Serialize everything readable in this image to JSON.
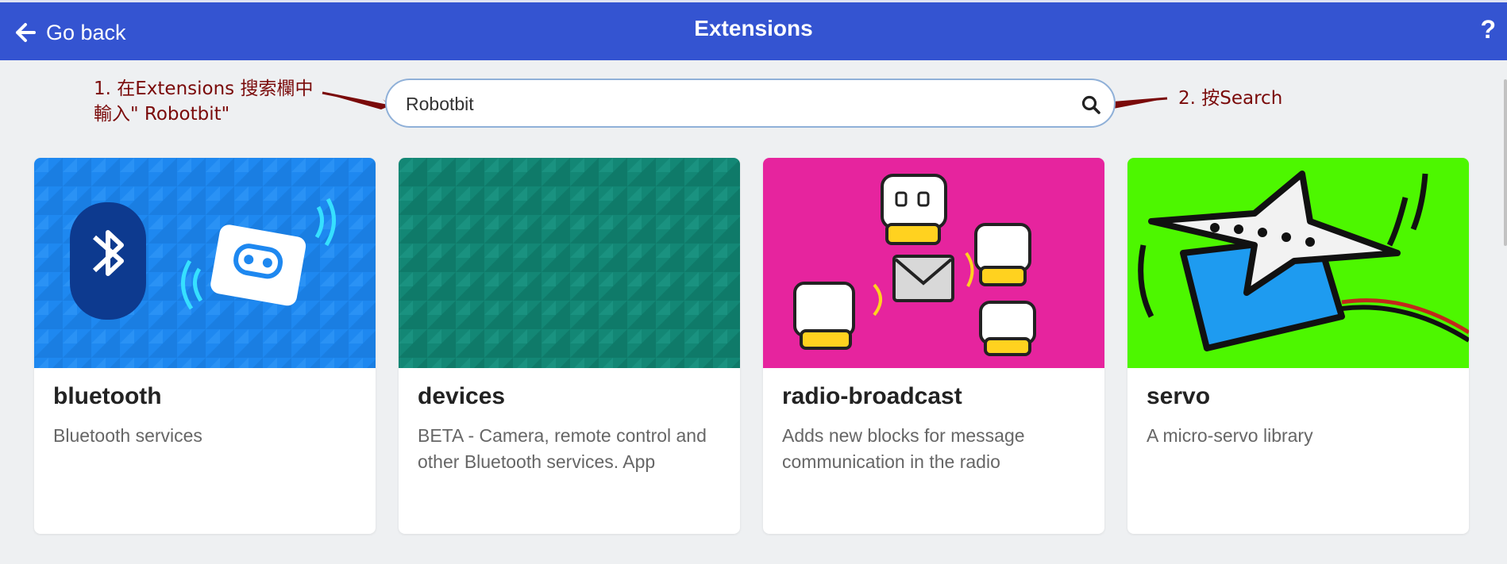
{
  "header": {
    "back_label": "Go back",
    "title": "Extensions",
    "help_label": "?"
  },
  "search": {
    "value": "Robotbit",
    "icon": "search-icon"
  },
  "annotations": {
    "step1_line1": "1. 在Extensions 搜索欄中",
    "step1_line2": "輸入\" Robotbit\"",
    "step2": "2. 按Search"
  },
  "cards": [
    {
      "name": "bluetooth",
      "description": "Bluetooth services"
    },
    {
      "name": "devices",
      "description": "BETA - Camera, remote control and other Bluetooth services. App"
    },
    {
      "name": "radio-broadcast",
      "description": "Adds new blocks for message communication in the radio"
    },
    {
      "name": "servo",
      "description": "A micro-servo library"
    }
  ],
  "colors": {
    "header": "#3454d1",
    "annotation": "#7a0a0a",
    "bluetooth_bg": "#1e88f0",
    "devices_bg": "#138775",
    "radio_bg": "#e6249e",
    "servo_bg": "#4df700"
  }
}
